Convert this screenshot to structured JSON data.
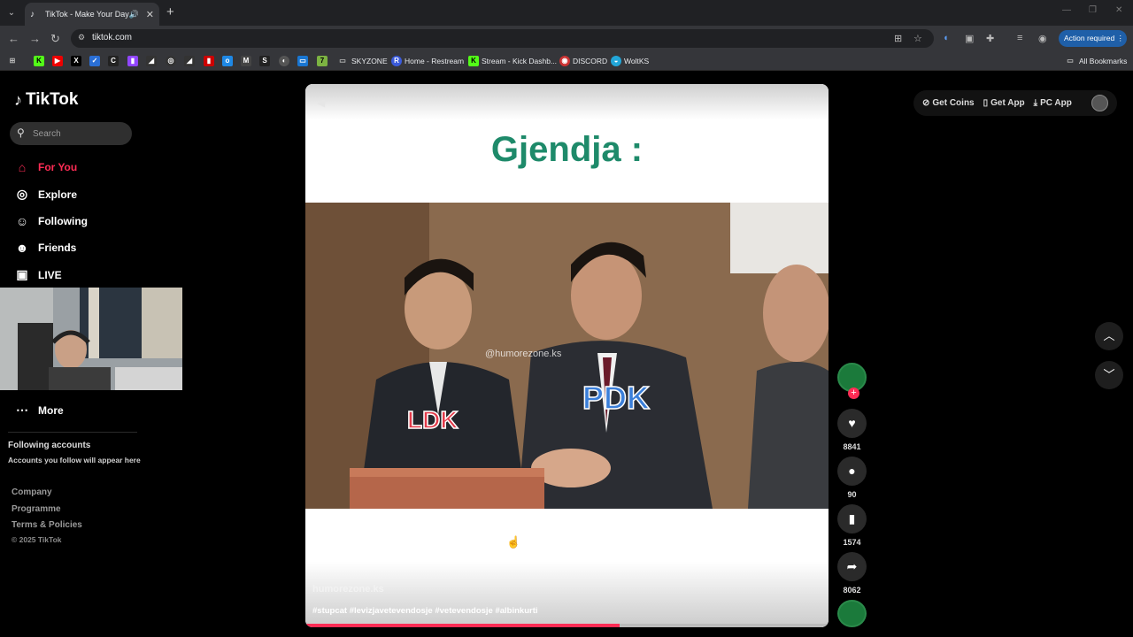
{
  "browser": {
    "tab_title": "TikTok - Make Your Day",
    "url": "tiktok.com",
    "action_required": "Action required",
    "bookmarks": [
      "SKYZONE",
      "Home - Restream",
      "Stream - Kick Dashb...",
      "DISCORD",
      "WoltKS"
    ],
    "all_bookmarks": "All Bookmarks"
  },
  "sidebar": {
    "logo": "TikTok",
    "search_placeholder": "Search",
    "items": [
      {
        "label": "For You"
      },
      {
        "label": "Explore"
      },
      {
        "label": "Following"
      },
      {
        "label": "Friends"
      },
      {
        "label": "LIVE"
      },
      {
        "label": "More"
      }
    ],
    "following_heading": "Following accounts",
    "following_sub": "Accounts you follow will appear here",
    "footer": [
      "Company",
      "Programme",
      "Terms & Policies"
    ],
    "copyright": "© 2025 TikTok"
  },
  "top_actions": {
    "get_coins": "Get Coins",
    "get_app": "Get App",
    "pc_app": "PC App"
  },
  "video": {
    "headline": "Gjendja :",
    "label_left": "LDK",
    "label_right": "PDK",
    "watermark": "@humorezone.ks",
    "author": "humorezone.ks",
    "hashtags": "#stupcat #levizjavetevendosje #vetevendosje #albinkurti",
    "progress": 0.6
  },
  "stats": {
    "likes": "8841",
    "comments": "90",
    "saves": "1574",
    "shares": "8062"
  },
  "colors": {
    "brand_red": "#fe2c55",
    "headline_green": "#1e8a6a",
    "ldk_red": "#e23a4a",
    "pdk_blue": "#3b7fd9"
  }
}
